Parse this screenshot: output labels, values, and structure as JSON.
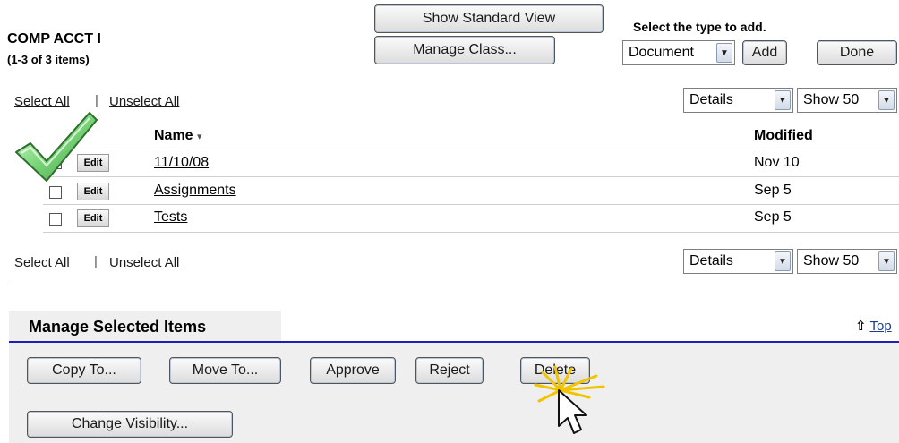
{
  "course": {
    "title": "COMP ACCT I",
    "item_count": "(1-3 of 3 items)"
  },
  "top_buttons": {
    "standard_view": "Show Standard View",
    "manage_class": "Manage Class..."
  },
  "add_section": {
    "label": "Select the type to add.",
    "type_value": "Document",
    "add": "Add",
    "done": "Done"
  },
  "selection": {
    "select_all": "Select All",
    "separator": "|",
    "unselect_all": "Unselect All"
  },
  "view_controls": {
    "view_value": "Details",
    "show_value": "Show 50"
  },
  "table": {
    "headers": {
      "name": "Name",
      "sort_indicator": "▾",
      "modified": "Modified"
    },
    "edit_label": "Edit",
    "rows": [
      {
        "name": "11/10/08",
        "modified": "Nov 10"
      },
      {
        "name": "Assignments",
        "modified": "Sep 5"
      },
      {
        "name": "Tests",
        "modified": "Sep 5"
      }
    ]
  },
  "manage": {
    "title": "Manage Selected Items",
    "top_link": "Top",
    "buttons": {
      "copy_to": "Copy To...",
      "move_to": "Move To...",
      "approve": "Approve",
      "reject": "Reject",
      "delete": "Delete",
      "change_visibility": "Change Visibility..."
    }
  },
  "colors": {
    "rule_blue": "#1f1fb4",
    "manage_band": "#efefef",
    "check_green": "#7bd67a"
  }
}
